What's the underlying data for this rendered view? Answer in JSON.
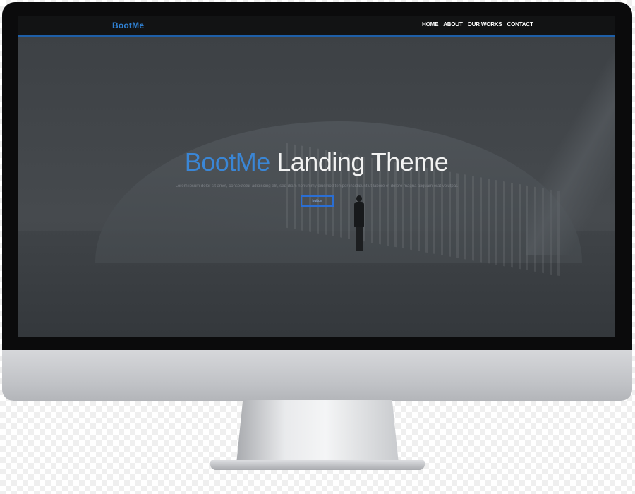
{
  "navbar": {
    "brand": "BootMe",
    "links": [
      "HOME",
      "ABOUT",
      "OUR WORKS",
      "CONTACT"
    ]
  },
  "hero": {
    "title_brand": "BootMe",
    "title_rest": " Landing Theme",
    "subtitle": "Lorem ipsum dolor sit amet, consectetur adipiscing elit, sed diam nonummy eiusmod tempor incididunt ut labore et dolore magna aliquam erat volutpat.",
    "button_label": "button"
  },
  "colors": {
    "brand_blue": "#3a86d6",
    "navbar_bg": "#121314",
    "bezel": "#0b0b0c"
  }
}
